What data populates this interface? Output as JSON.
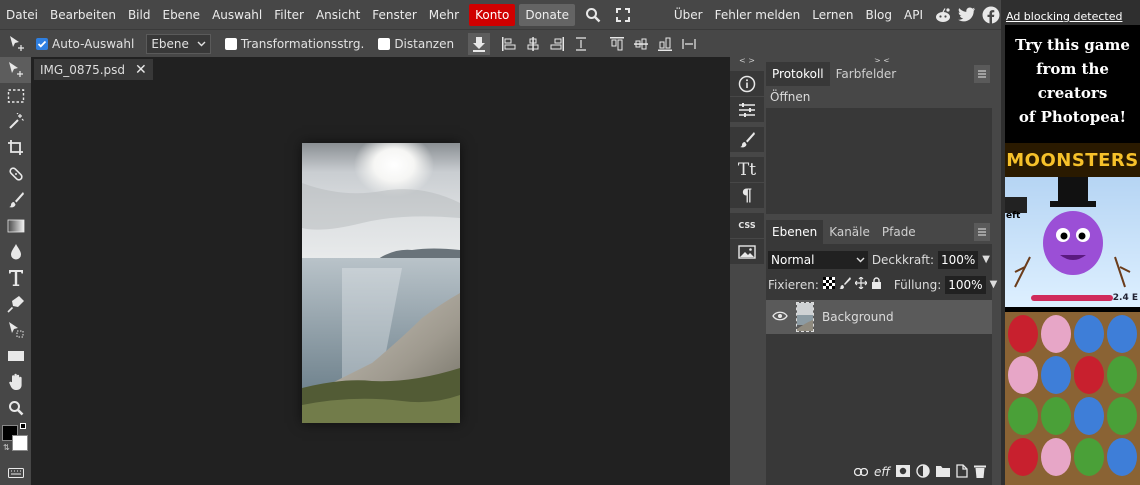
{
  "menu": {
    "items": [
      "Datei",
      "Bearbeiten",
      "Bild",
      "Ebene",
      "Auswahl",
      "Filter",
      "Ansicht",
      "Fenster",
      "Mehr"
    ],
    "konto": "Konto",
    "donate": "Donate",
    "right_links": [
      "Über",
      "Fehler melden",
      "Lernen",
      "Blog",
      "API"
    ]
  },
  "options": {
    "auto_select_label": "Auto-Auswahl",
    "auto_select_checked": true,
    "target_select": "Ebene",
    "transform_label": "Transformationsstrg.",
    "distances_label": "Distanzen"
  },
  "document": {
    "tab_name": "IMG_0875.psd"
  },
  "side_icons": {
    "text_glyph": "Tt",
    "paragraph_glyph": "¶",
    "css_label": "CSS"
  },
  "history_panel": {
    "tabs": [
      "Protokoll",
      "Farbfelder"
    ],
    "entries": [
      "Öffnen"
    ]
  },
  "layers_panel": {
    "tabs": [
      "Ebenen",
      "Kanäle",
      "Pfade"
    ],
    "blend_mode": "Normal",
    "opacity_label": "Deckkraft:",
    "opacity_value": "100%",
    "lock_label": "Fixieren:",
    "fill_label": "Füllung:",
    "fill_value": "100%",
    "layers": [
      {
        "name": "Background",
        "visible": true
      }
    ],
    "footer_eff": "eff"
  },
  "ad": {
    "label": "Ad blocking detected",
    "headline": [
      "Try this game",
      "from the",
      "creators",
      "of Photopea!"
    ],
    "brand": "MOONSTERS",
    "banner_left": "eft",
    "banner_right": "2.4 E"
  },
  "colors": {
    "accent_red": "#d00000",
    "check_blue": "#2f7fe0",
    "panel_bg": "#383838",
    "chrome_bg": "#474747",
    "canvas_bg": "#212121"
  }
}
